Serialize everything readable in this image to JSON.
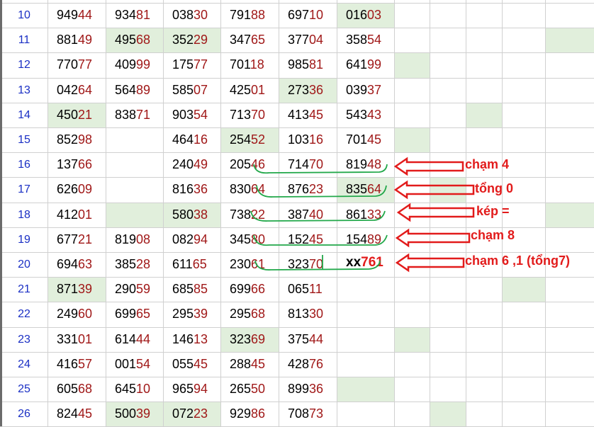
{
  "rows": [
    {
      "n": "10",
      "cells": [
        "94944",
        "93481",
        "03830",
        "79188",
        "69710",
        "01603",
        "",
        "",
        ""
      ]
    },
    {
      "n": "11",
      "cells": [
        "88149",
        "49568",
        "35229",
        "34765",
        "37704",
        "35854",
        "",
        "",
        ""
      ]
    },
    {
      "n": "12",
      "cells": [
        "77077",
        "40999",
        "17577",
        "70118",
        "98581",
        "64199",
        "",
        "",
        ""
      ]
    },
    {
      "n": "13",
      "cells": [
        "04264",
        "56489",
        "58507",
        "42501",
        "27336",
        "03937",
        "",
        "",
        ""
      ]
    },
    {
      "n": "14",
      "cells": [
        "45021",
        "83871",
        "90354",
        "71370",
        "41345",
        "54343",
        "",
        "",
        ""
      ]
    },
    {
      "n": "15",
      "cells": [
        "85298",
        "",
        "46416",
        "25452",
        "10316",
        "70145",
        "",
        "",
        ""
      ]
    },
    {
      "n": "16",
      "cells": [
        "13766",
        "",
        "24049",
        "20546",
        "71470",
        "81948",
        "",
        "",
        ""
      ]
    },
    {
      "n": "17",
      "cells": [
        "62609",
        "",
        "81636",
        "83064",
        "87623",
        "83564",
        "",
        "",
        ""
      ]
    },
    {
      "n": "18",
      "cells": [
        "41201",
        "",
        "58038",
        "73822",
        "38740",
        "86133",
        "",
        "",
        ""
      ]
    },
    {
      "n": "19",
      "cells": [
        "67721",
        "81908",
        "08294",
        "34580",
        "15245",
        "15489",
        "",
        "",
        ""
      ]
    },
    {
      "n": "20",
      "cells": [
        "69463",
        "38528",
        "61165",
        "23061",
        "32370",
        "",
        "",
        "",
        ""
      ]
    },
    {
      "n": "21",
      "cells": [
        "87139",
        "29059",
        "68585",
        "69966",
        "06511",
        "",
        "",
        "",
        ""
      ]
    },
    {
      "n": "22",
      "cells": [
        "24960",
        "69965",
        "29539",
        "29568",
        "81330",
        "",
        "",
        "",
        ""
      ]
    },
    {
      "n": "23",
      "cells": [
        "33101",
        "61444",
        "14613",
        "32369",
        "37544",
        "",
        "",
        "",
        ""
      ]
    },
    {
      "n": "24",
      "cells": [
        "41657",
        "00154",
        "05545",
        "28845",
        "42876",
        "",
        "",
        "",
        ""
      ]
    },
    {
      "n": "25",
      "cells": [
        "60568",
        "64510",
        "96594",
        "26550",
        "89936",
        "",
        "",
        "",
        ""
      ]
    },
    {
      "n": "26",
      "cells": [
        "82445",
        "50039",
        "07223",
        "92986",
        "70873",
        "",
        "",
        "",
        ""
      ]
    }
  ],
  "row20_extra": {
    "prefix": "xx",
    "value": "761"
  },
  "annotations": [
    {
      "text": "chạm 4"
    },
    {
      "text": "tổng 0"
    },
    {
      "text": "kép ="
    },
    {
      "text": "chạm 8"
    },
    {
      "text": "chạm 6 ,1  (tổng7)"
    }
  ],
  "colors": {
    "highlight": "#e1efdc",
    "row_number": "#1a2fc4",
    "digit_tail": "#a01818",
    "annotation": "#e21b1b",
    "bracket": "#22a84a",
    "gridline": "#d0d0d0"
  }
}
